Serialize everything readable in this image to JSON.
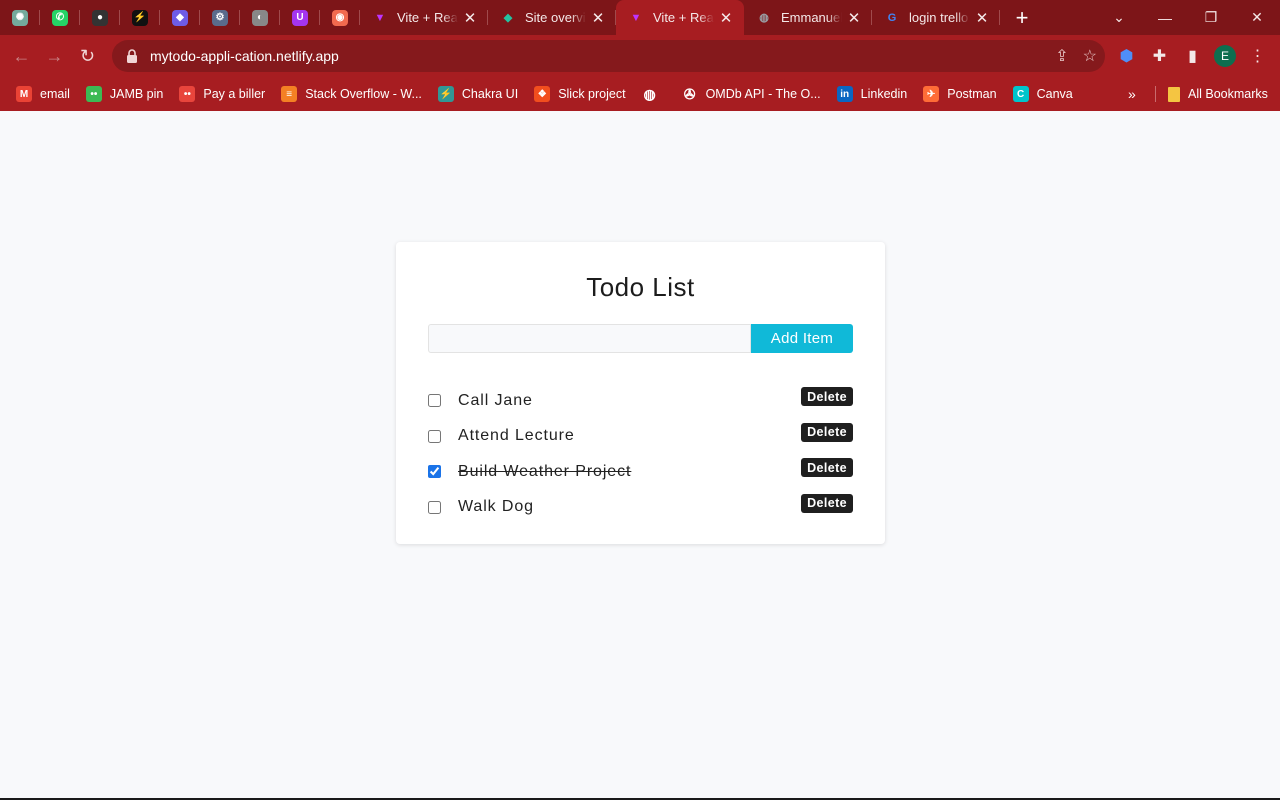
{
  "browser": {
    "pinned_tabs": [
      {
        "icon": "chatgpt-icon",
        "color": "#74aa9c",
        "glyph": "✺"
      },
      {
        "icon": "whatsapp-icon",
        "color": "#25d366",
        "glyph": "✆"
      },
      {
        "icon": "github-icon",
        "color": "#333333",
        "glyph": "●"
      },
      {
        "icon": "vercel-icon",
        "color": "#111111",
        "glyph": "⚡"
      },
      {
        "icon": "prism-icon",
        "color": "#6e5ce6",
        "glyph": "◆"
      },
      {
        "icon": "settings-gear-icon",
        "color": "#5a6b8c",
        "glyph": "⚙"
      },
      {
        "icon": "globe-icon",
        "color": "#888888",
        "glyph": "◐"
      },
      {
        "icon": "udemy-icon",
        "color": "#a435f0",
        "glyph": "U"
      },
      {
        "icon": "scrimba-icon",
        "color": "#f26a4f",
        "glyph": "◉"
      }
    ],
    "tabs": [
      {
        "title": "Vite + React",
        "icon": "vite-icon",
        "active": false
      },
      {
        "title": "Site overview",
        "icon": "netlify-icon",
        "active": false
      },
      {
        "title": "Vite + React",
        "icon": "vite-icon",
        "active": true
      },
      {
        "title": "Emmanuel A",
        "icon": "globe-icon",
        "active": false
      },
      {
        "title": "login trello",
        "icon": "google-icon",
        "active": false
      }
    ],
    "url": "mytodo-appli-cation.netlify.app",
    "profile_initial": "E",
    "bookmarks": [
      {
        "label": "email",
        "icon": "gmail-icon",
        "color": "#ea4335",
        "glyph": "M"
      },
      {
        "label": "JAMB pin",
        "icon": "dots-icon",
        "color": "#3cba54",
        "glyph": "••"
      },
      {
        "label": "Pay a biller",
        "icon": "dots-icon",
        "color": "#e8453c",
        "glyph": "••"
      },
      {
        "label": "Stack Overflow - W...",
        "icon": "stackoverflow-icon",
        "color": "#f48024",
        "glyph": "≡"
      },
      {
        "label": "Chakra UI",
        "icon": "chakra-icon",
        "color": "#319795",
        "glyph": "⚡"
      },
      {
        "label": "Slick project",
        "icon": "figma-icon",
        "color": "#f24e1e",
        "glyph": "❖"
      },
      {
        "label": "",
        "icon": "globe-icon",
        "color": "#ffffff",
        "glyph": "◍"
      },
      {
        "label": "OMDb API - The O...",
        "icon": "film-reel-icon",
        "color": "#ffffff",
        "glyph": "✇"
      },
      {
        "label": "Linkedin",
        "icon": "linkedin-icon",
        "color": "#0a66c2",
        "glyph": "in"
      },
      {
        "label": "Postman",
        "icon": "postman-icon",
        "color": "#ff6c37",
        "glyph": "✈"
      },
      {
        "label": "Canva",
        "icon": "canva-icon",
        "color": "#00c4cc",
        "glyph": "C"
      }
    ],
    "more_bookmarks": "»",
    "all_bookmarks": "All Bookmarks"
  },
  "app": {
    "title": "Todo List",
    "input_value": "",
    "add_button": "Add Item",
    "delete_label": "Delete",
    "todos": [
      {
        "text": "Call Jane",
        "done": false
      },
      {
        "text": "Attend Lecture",
        "done": false
      },
      {
        "text": "Build Weather Project",
        "done": true
      },
      {
        "text": "Walk Dog",
        "done": false
      }
    ]
  },
  "colors": {
    "chrome_dark": "#7d1518",
    "chrome_main": "#a71d21",
    "accent": "#10b9d8",
    "delete_bg": "#1f1f1f"
  }
}
